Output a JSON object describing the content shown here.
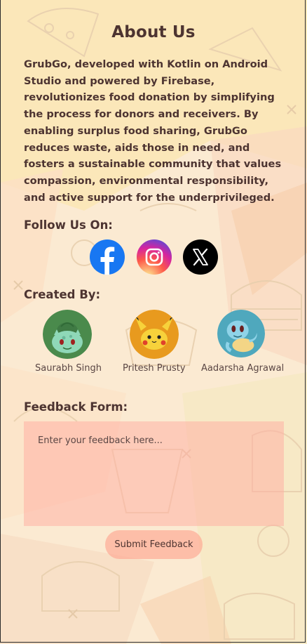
{
  "about": {
    "title": "About Us",
    "description": "GrubGo, developed with Kotlin on Android Studio and powered by Firebase, revolutionizes food donation by simplifying the process for donors and receivers. By enabling surplus food sharing, GrubGo reduces waste, aids those in need, and fosters a sustainable community that values compassion, environmental responsibility, and active support for the underprivileged."
  },
  "follow": {
    "heading": "Follow Us On:",
    "links": [
      {
        "icon": "facebook-icon",
        "color": "#1877F2"
      },
      {
        "icon": "instagram-icon",
        "color": "#E1306C"
      },
      {
        "icon": "x-icon",
        "color": "#000000"
      }
    ]
  },
  "creators": {
    "heading": "Created By:",
    "people": [
      {
        "name": "Saurabh Singh",
        "avatar": "bulbasaur-avatar"
      },
      {
        "name": "Pritesh Prusty",
        "avatar": "pikachu-avatar"
      },
      {
        "name": "Aadarsha Agrawal",
        "avatar": "squirtle-avatar"
      }
    ]
  },
  "feedback": {
    "heading": "Feedback Form:",
    "placeholder": "Enter your feedback here...",
    "submit_label": "Submit Feedback"
  }
}
